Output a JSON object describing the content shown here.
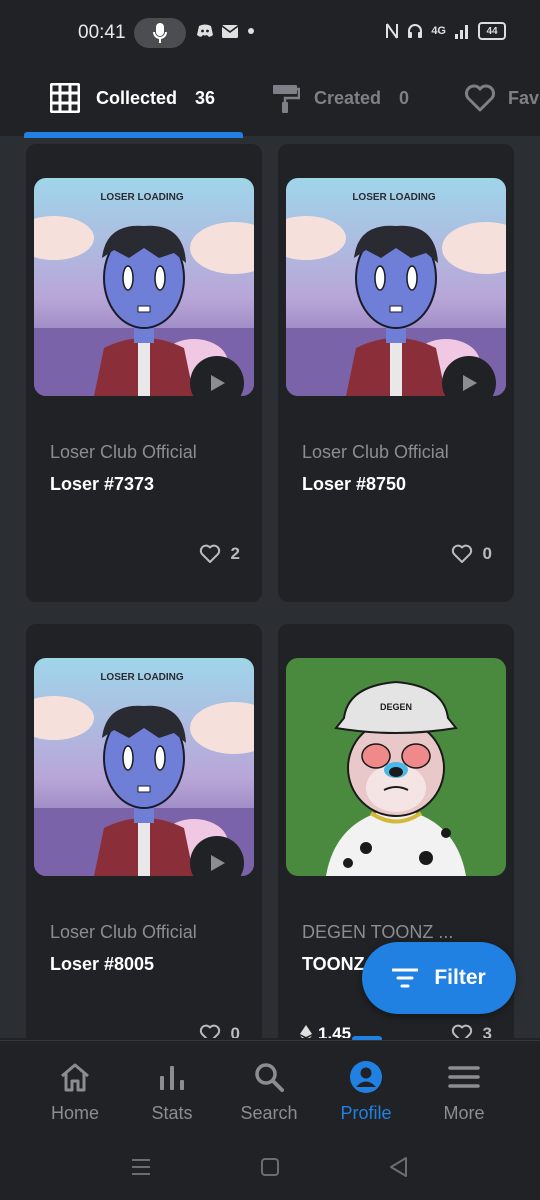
{
  "status_bar": {
    "time": "00:41",
    "battery": "44",
    "network": "4G"
  },
  "tabs": [
    {
      "label": "Collected",
      "count": "36"
    },
    {
      "label": "Created",
      "count": "0"
    },
    {
      "label": "Fav"
    }
  ],
  "cards": [
    {
      "collection": "Loser Club Official",
      "name": "Loser #7373",
      "likes": "2",
      "has_play": true
    },
    {
      "collection": "Loser Club Official",
      "name": "Loser #8750",
      "likes": "0",
      "has_play": true
    },
    {
      "collection": "Loser Club Official",
      "name": "Loser #8005",
      "likes": "0",
      "has_play": true
    },
    {
      "collection": "DEGEN TOONZ ...",
      "name": "TOONZ",
      "likes": "3",
      "price": "1.45"
    }
  ],
  "artwork_text": {
    "loser_logo": "LOSER LOADING",
    "degen_hat": "DEGEN"
  },
  "filter_button": {
    "label": "Filter"
  },
  "bottom_nav": [
    {
      "label": "Home",
      "icon": "home-icon"
    },
    {
      "label": "Stats",
      "icon": "stats-icon"
    },
    {
      "label": "Search",
      "icon": "search-icon"
    },
    {
      "label": "Profile",
      "icon": "profile-icon",
      "active": true
    },
    {
      "label": "More",
      "icon": "menu-icon"
    }
  ],
  "colors": {
    "accent": "#2081e2",
    "background": "#202225",
    "card": "#202225",
    "grid": "#2b2f33"
  }
}
